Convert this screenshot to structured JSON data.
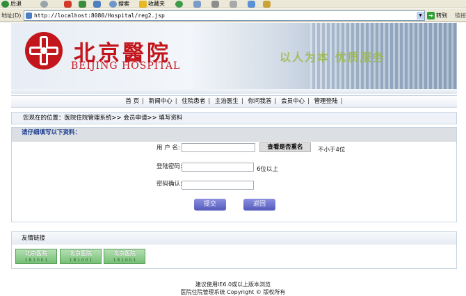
{
  "toolbar": {
    "back_label": "后退",
    "search_label": "搜索",
    "favorites_label": "收藏夹"
  },
  "address_bar": {
    "label": "地址(D)",
    "url": "http://localhost:8080/Hospital/reg2.jsp",
    "go_label": "转到",
    "links_label": "链接"
  },
  "banner": {
    "name_cn": "北京醫院",
    "name_en": "BEIJING HOSPITAL",
    "slogan": "以人为本 优质服务"
  },
  "nav": {
    "items": [
      "首 页",
      "新闻中心",
      "住院患者",
      "主治医生",
      "你问我答",
      "会员中心",
      "管理登陆"
    ]
  },
  "breadcrumb": {
    "label": "您现在的位置：",
    "path": "医院住院管理系统>> 会员申请>> 填写资料"
  },
  "form": {
    "header": "请仔细填写以下资料：",
    "username_label": "用 户 名:",
    "username_value": "",
    "check_button": "查看是否重名",
    "username_hint": "不小于4位",
    "password_label": "登陆密码:",
    "password_value": "",
    "password_hint": "6位以上",
    "confirm_label": "密码确认:",
    "confirm_value": "",
    "submit_label": "提交",
    "reset_label": "返回"
  },
  "links_section": {
    "title": "友情链接",
    "badges": [
      {
        "title": "北京医院",
        "sub": "1 8 1 0 0 1"
      },
      {
        "title": "北京医院",
        "sub": "1 8 1 0 0 1"
      },
      {
        "title": "北京医院",
        "sub": "1 8 1 0 0 1"
      }
    ]
  },
  "footer": {
    "line1": "建议使用IE6.0或以上版本浏览",
    "line2": "医院住院管理系统 Copyright © 版权所有"
  },
  "colors": {
    "brand_red": "#c3161c",
    "button_purple": "#5359bb",
    "header_blue": "#1a3c8e"
  }
}
